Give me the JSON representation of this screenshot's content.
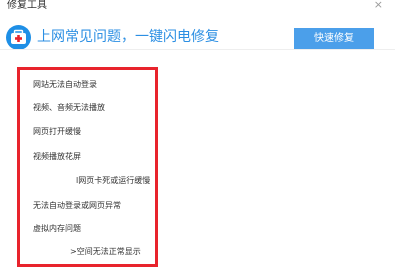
{
  "window": {
    "title": "修复工具",
    "close_glyph": "×"
  },
  "header": {
    "icon": "first-aid-kit-icon",
    "headline": "上网常见问题，一键闪电修复",
    "quick_fix_label": "快速修复"
  },
  "issues": [
    "网站无法自动登录",
    "视频、音频无法播放",
    "网页打开缓慢",
    "视频播放花屏",
    "l网页卡死或运行缓慢",
    "无法自动登录或网页异常",
    "虚拟内存问题",
    ">空间无法正常显示"
  ],
  "colors": {
    "accent": "#2c8fe3",
    "button": "#4b9fea",
    "highlight_border": "#e8232c"
  }
}
